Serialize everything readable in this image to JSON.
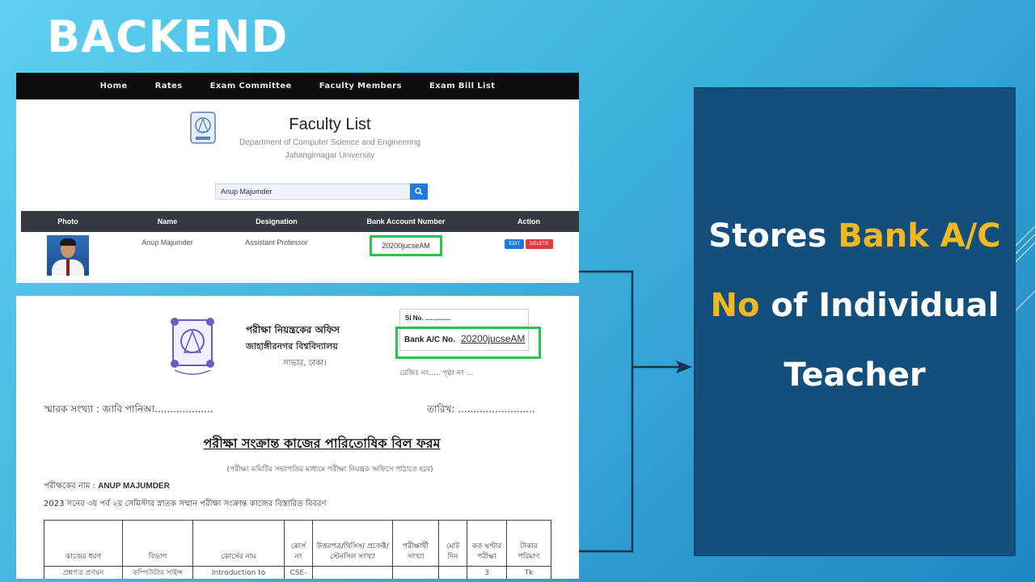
{
  "slide": {
    "title": "BACKEND"
  },
  "faculty_page": {
    "nav": [
      "Home",
      "Rates",
      "Exam Committee",
      "Faculty Members",
      "Exam Bill List"
    ],
    "title": "Faculty List",
    "department": "Department of Computer Science and Engineering",
    "university": "Jahangirnagar University",
    "search": {
      "value": "Anup Majumder",
      "icon": "search-icon"
    },
    "table": {
      "columns": [
        "Photo",
        "Name",
        "Designation",
        "Bank Account Number",
        "Action"
      ],
      "rows": [
        {
          "name": "Anup Majumder",
          "designation": "Assistant Professor",
          "bank_account": "20200jucseAM",
          "actions": [
            "EDIT",
            "DELETE"
          ]
        }
      ]
    },
    "highlight_color": "#29c44a"
  },
  "bill_form": {
    "office": "পরীক্ষা নিয়ন্ত্রকের অফিস",
    "university": "জাহাঙ্গীরনগর বিশ্ববিদ্যালয়",
    "place": "সাভার, ঢাকা।",
    "sl_no": "Sl No. ..............",
    "bank_label": "Bank A/C No.",
    "bank_value": "20200jucseAM",
    "reg": "রেজিঃ নং..... পৃষ্ঠা নং ...",
    "memo": "স্মারক সংখ্যা : জাবি পানিআ...................",
    "date": "তারিখ: .........................",
    "form_title": "পরীক্ষা সংক্রান্ত কাজের পারিতোষিক বিল ফরম",
    "form_subtitle": "(পরীক্ষা কমিটির সভাপতির মাধ্যমে পরীক্ষা নিয়ন্ত্রক অফিসে পাঠাতে হবে)",
    "examiner_label": "পরীক্ষকের নাম :",
    "examiner_name": "ANUP MAJUMDER",
    "session_line": "2023 সনের ৩য় পর্ব ২য় সেমিস্টার স্নাতক সম্মান পরীক্ষা সংক্রান্ত কাজের বিস্তারিত বিবরণ",
    "table_headers": [
      "কাজের ধরণ",
      "বিভাগ",
      "কোর্সের নাম",
      "কোর্স নং",
      "উত্তরপত্র/থিসিস/ প্রজেক্ট/স্টেনসিল সংখ্যা",
      "পরীক্ষার্থী সংখ্যা",
      "মোট দিন",
      "কত ঘণ্টার পরীক্ষা",
      "টাকার পরিমাণ"
    ],
    "first_row": [
      "প্রশ্নপত্র প্রণয়ন",
      "কম্পিউটার সাইন্স",
      "Introduction to",
      "CSE-",
      "",
      "",
      "",
      "3",
      "Tk"
    ]
  },
  "panel": {
    "line1_a": "Stores ",
    "line1_b": "Bank A/C",
    "line2_a": "No",
    "line2_b": " of Individual",
    "line3": "Teacher",
    "highlight_color": "#f2b820",
    "background": "#134f7c"
  }
}
